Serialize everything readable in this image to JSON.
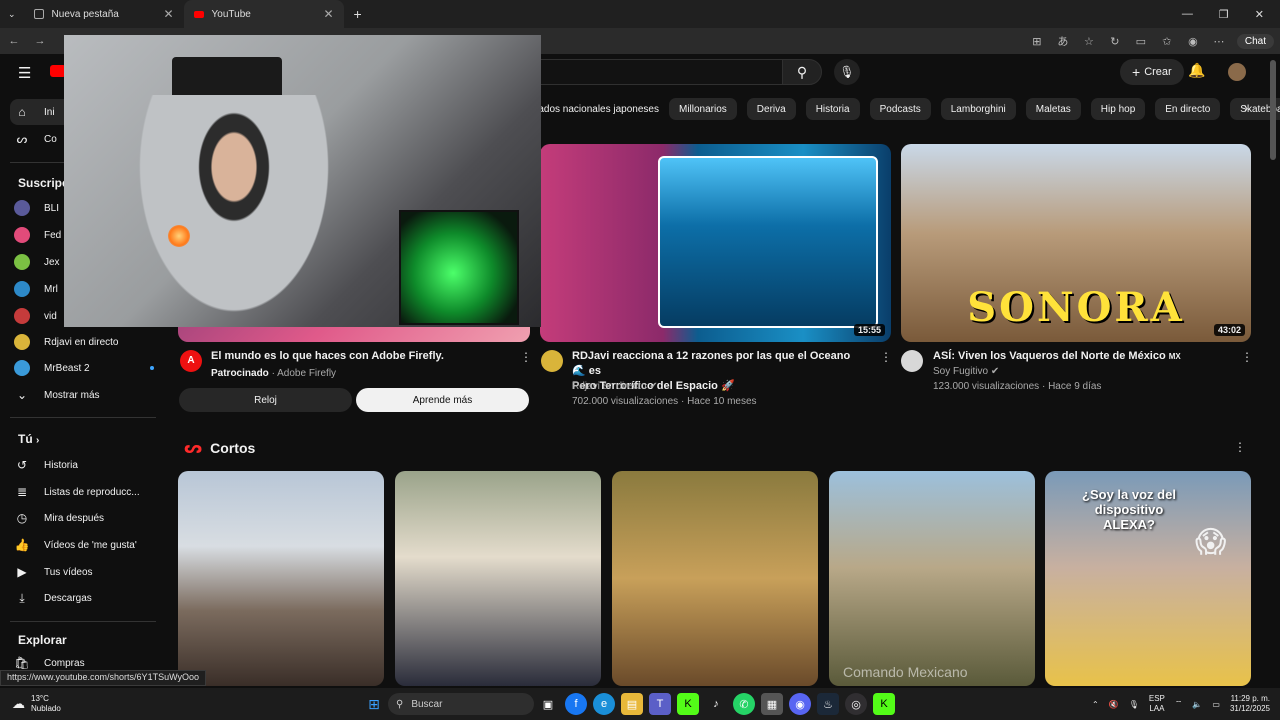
{
  "browser": {
    "tabs": [
      {
        "label": "Nueva pestaña"
      },
      {
        "label": "YouTube"
      }
    ],
    "chat_label": "Chat"
  },
  "youtube": {
    "create_label": "Crear",
    "chips": [
      "rcados nacionales japoneses",
      "Millonarios",
      "Deriva",
      "Historia",
      "Podcasts",
      "Lamborghini",
      "Maletas",
      "Hip hop",
      "En directo",
      "Skateboarding"
    ]
  },
  "sidebar": {
    "top": [
      {
        "label": "Ini",
        "icon": "home-icon"
      },
      {
        "label": "Co",
        "icon": "shorts-icon"
      }
    ],
    "subs_heading": "Suscripci",
    "subs": [
      {
        "label": "BLI",
        "color": "#5a5a9a"
      },
      {
        "label": "Fed",
        "color": "#e24b7a"
      },
      {
        "label": "Jex",
        "color": "#7bc043"
      },
      {
        "label": "Mrl",
        "color": "#2d89c8"
      },
      {
        "label": "vid",
        "color": "#c53b3b"
      },
      {
        "label": "Rdjavi en directo",
        "color": "#d9b43a"
      },
      {
        "label": "MrBeast 2",
        "color": "#3a9ad9"
      }
    ],
    "more_label": "Mostrar más",
    "you_heading": "Tú",
    "you": [
      {
        "label": "Historia",
        "icon": "history-icon"
      },
      {
        "label": "Listas de reproducc...",
        "icon": "playlist-icon"
      },
      {
        "label": "Mira después",
        "icon": "clock-icon"
      },
      {
        "label": "Vídeos de 'me gusta'",
        "icon": "like-icon"
      },
      {
        "label": "Tus vídeos",
        "icon": "video-icon"
      },
      {
        "label": "Descargas",
        "icon": "download-icon"
      }
    ],
    "explore_heading": "Explorar",
    "explore": [
      {
        "label": "Compras",
        "icon": "bag-icon"
      }
    ]
  },
  "videos": [
    {
      "title": "El mundo es lo que haces con Adobe Firefly.",
      "meta1_bold": "Patrocinado",
      "meta1": " · Adobe Firefly",
      "btn1": "Reloj",
      "btn2": "Aprende más"
    },
    {
      "title": "RDJavi reacciona a 12 razones por las que el Oceano 🌊 es",
      "title2": "Pero Terrorífico del Espacio 🚀",
      "channel": "Rdjavi en directo",
      "meta": "702.000 visualizaciones · Hace 10 meses",
      "duration": "15:55"
    },
    {
      "title": "ASÍ: Viven los Vaqueros del Norte de México",
      "title_suffix": "MX",
      "channel": "Soy Fugitivo",
      "meta": "123.000 visualizaciones · Hace 9 días",
      "duration": "43:02",
      "thumb_text": "SONORA"
    }
  ],
  "shorts": {
    "heading": "Cortos",
    "alexa_text": "¿Soy la voz del dispositivo ALEXA?",
    "watermark": "Comando Mexicano"
  },
  "status_url": "https://www.youtube.com/shorts/6Y1TSuWyOoo",
  "taskbar": {
    "weather_temp": "13°C",
    "weather_desc": "Nublado",
    "search_label": "Buscar",
    "lang1": "ESP",
    "lang2": "LAA",
    "time": "11:29 p. m.",
    "date": "31/12/2025"
  }
}
